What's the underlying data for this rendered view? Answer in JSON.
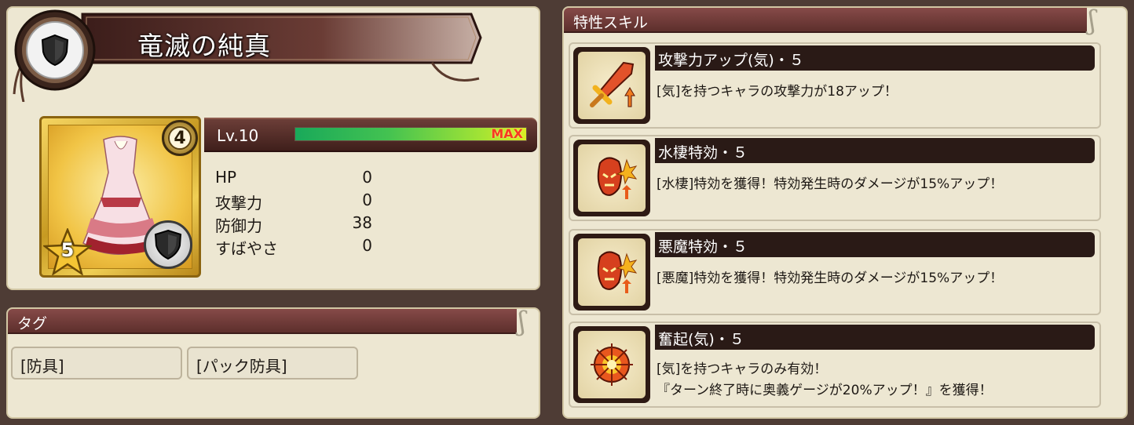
{
  "item": {
    "name": "竜滅の純真",
    "type_icon": "shield-icon",
    "card_level_badge": "4",
    "rarity_stars": "5",
    "level": "Lv.10",
    "exp_fill_fraction": 1.0,
    "exp_max_label": "MAX"
  },
  "stats": [
    {
      "label": "HP",
      "value": "0"
    },
    {
      "label": "攻撃力",
      "value": "0"
    },
    {
      "label": "防御力",
      "value": "38"
    },
    {
      "label": "すばやさ",
      "value": "0"
    }
  ],
  "tags": {
    "header": "タグ",
    "items": [
      "[防具]",
      "[パック防具]"
    ]
  },
  "skills": {
    "header": "特性スキル",
    "items": [
      {
        "name": "攻撃力アップ(気)・５",
        "desc": [
          "[気]を持つキャラの攻撃力が18アップ！"
        ],
        "icon": "sword-icon"
      },
      {
        "name": "水棲特効・５",
        "desc": [
          "[水棲]特効を獲得！特効発生時のダメージが15%アップ！"
        ],
        "icon": "demon-face-icon"
      },
      {
        "name": "悪魔特効・５",
        "desc": [
          "[悪魔]特効を獲得！特効発生時のダメージが15%アップ！"
        ],
        "icon": "demon-face-icon"
      },
      {
        "name": "奮起(気)・５",
        "desc": [
          "[気]を持つキャラのみ有効！",
          "『ターン終了時に奥義ゲージが20%アップ！』を獲得！"
        ],
        "icon": "burst-emblem-icon"
      }
    ]
  },
  "colors": {
    "panel_bg": "#ede7d2",
    "header_maroon": "#6e3a37",
    "skill_name_bg": "#2a1a16",
    "exp_max_red": "#f63b23"
  }
}
